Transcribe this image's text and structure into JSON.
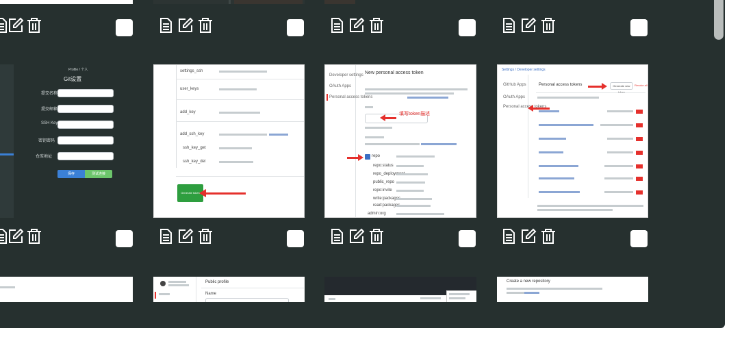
{
  "icons": {
    "view": "document-icon",
    "edit": "edit-icon",
    "delete": "trash-icon"
  },
  "colors": {
    "panel": "#26302f",
    "arrow": "#e5302c",
    "green_button": "#2e9e3f",
    "link": "#3b6fc4"
  },
  "thumb_settings": {
    "title": "Profile / 个人",
    "header": "Git设置",
    "labels": [
      "提交名称",
      "提交邮箱",
      "SSH Key",
      "密钥密码",
      "仓库地址"
    ],
    "buttons": [
      "保存",
      "测试连接"
    ]
  },
  "thumb_ssh": {
    "rows": [
      "settings_ssh",
      "user_keys",
      "add_key",
      "add_ssh_key",
      "ssh_key_get",
      "ssh_key_del"
    ],
    "button": "Generate token"
  },
  "thumb_token_form": {
    "title": "New personal access token",
    "side": [
      "Developer settings",
      "OAuth Apps",
      "Personal access tokens"
    ],
    "note_annotation": "填写token描述",
    "scopes": [
      "repo",
      "repo:status",
      "repo_deployment",
      "public_repo",
      "repo:invite",
      "write:packages",
      "read:packages",
      "admin:org"
    ]
  },
  "thumb_token_list": {
    "title": "Personal access tokens",
    "breadcrumb": "Settings / Developer settings",
    "side": [
      "GitHub Apps",
      "OAuth Apps",
      "Personal access tokens"
    ],
    "generate": "Generate new token",
    "revoke": "Revoke all",
    "rows": 6
  },
  "thumb_profile": {
    "title": "Public profile",
    "name_label": "Name"
  },
  "thumb_repo": {
    "title": "Create a new repository"
  }
}
